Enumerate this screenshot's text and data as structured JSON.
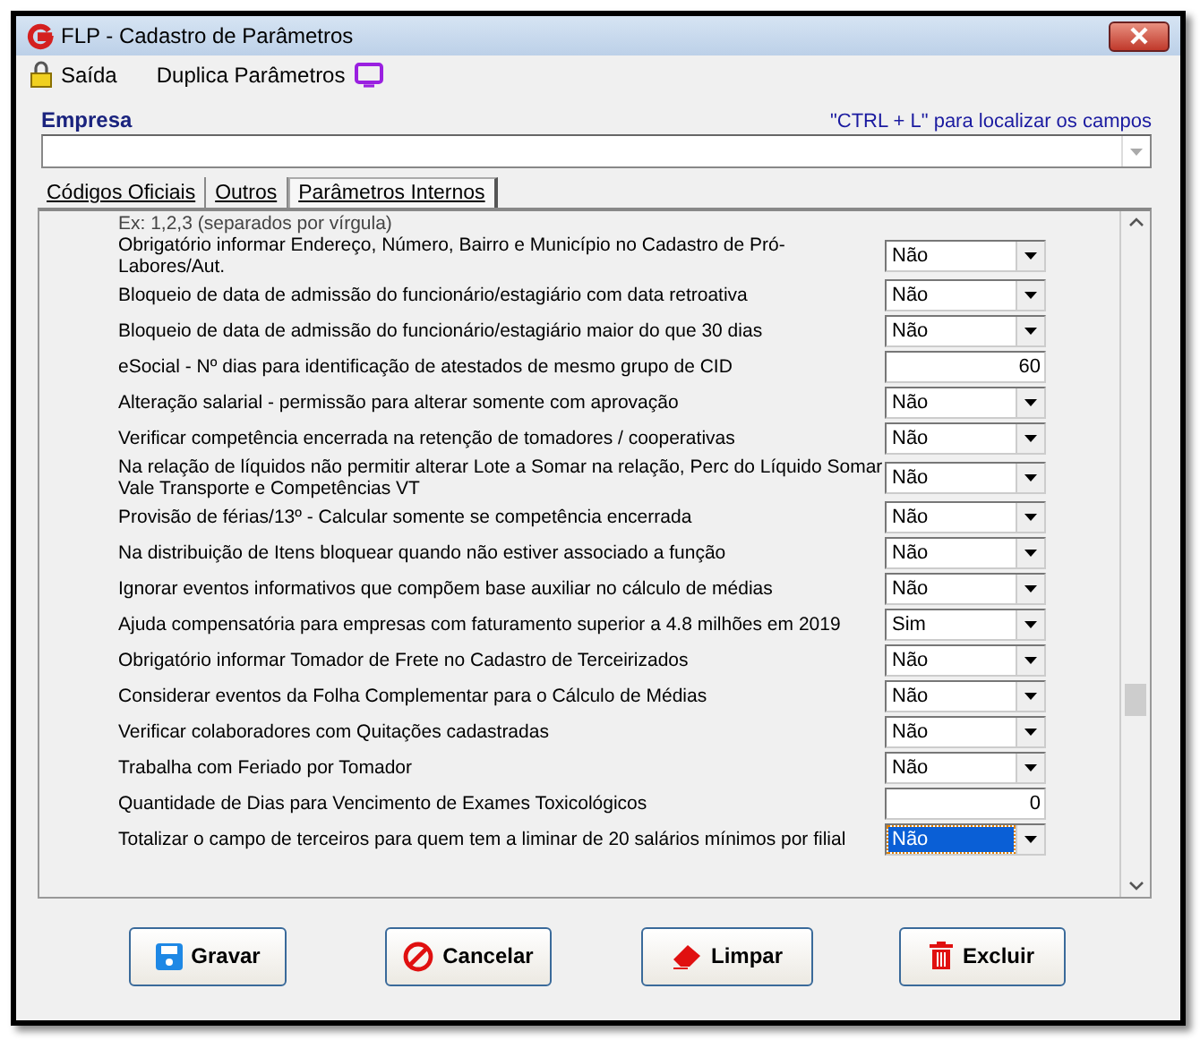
{
  "window": {
    "title": "FLP - Cadastro de Parâmetros"
  },
  "toolbar": [
    {
      "label": "Saída"
    },
    {
      "label": "Duplica Parâmetros"
    }
  ],
  "empresa": {
    "label": "Empresa",
    "hint": "\"CTRL + L\" para localizar os campos"
  },
  "tabs": [
    {
      "label": "Códigos Oficiais",
      "selected": false
    },
    {
      "label": "Outros",
      "selected": false
    },
    {
      "label": "Parâmetros Internos",
      "selected": true
    }
  ],
  "params": [
    {
      "kind": "note",
      "label": "Ex: 1,2,3 (separados por vírgula)"
    },
    {
      "kind": "select",
      "label": "Obrigatório informar Endereço, Número, Bairro e Município no Cadastro de Pró-Labores/Aut.",
      "value": "Não",
      "focused": false
    },
    {
      "kind": "select",
      "label": "Bloqueio de data de admissão do funcionário/estagiário com data retroativa",
      "value": "Não",
      "focused": false
    },
    {
      "kind": "select",
      "label": "Bloqueio de data de admissão do funcionário/estagiário maior do que 30 dias",
      "value": "Não",
      "focused": false
    },
    {
      "kind": "number",
      "label": "eSocial - Nº dias para identificação de atestados de mesmo grupo de CID",
      "value": "60"
    },
    {
      "kind": "select",
      "label": "Alteração salarial - permissão para alterar somente com aprovação",
      "value": "Não",
      "focused": false
    },
    {
      "kind": "select",
      "label": "Verificar competência encerrada na retenção de tomadores / cooperativas",
      "value": "Não",
      "focused": false
    },
    {
      "kind": "select",
      "label": "Na relação de líquidos não permitir alterar Lote a Somar na relação, Perc do Líquido Somar Vale Transporte e  Competências VT",
      "value": "Não",
      "focused": false
    },
    {
      "kind": "select",
      "label": "Provisão de férias/13º - Calcular somente se competência encerrada",
      "value": "Não",
      "focused": false
    },
    {
      "kind": "select",
      "label": "Na distribuição de Itens bloquear quando não estiver associado a função",
      "value": "Não",
      "focused": false
    },
    {
      "kind": "select",
      "label": "Ignorar eventos informativos que compõem base auxiliar no cálculo de médias",
      "value": "Não",
      "focused": false
    },
    {
      "kind": "select",
      "label": "Ajuda compensatória para empresas com faturamento superior a 4.8 milhões em 2019",
      "value": "Sim",
      "focused": false
    },
    {
      "kind": "select",
      "label": "Obrigatório informar Tomador de Frete no Cadastro de Terceirizados",
      "value": "Não",
      "focused": false
    },
    {
      "kind": "select",
      "label": "Considerar eventos da Folha Complementar para o Cálculo de Médias",
      "value": "Não",
      "focused": false
    },
    {
      "kind": "select",
      "label": "Verificar colaboradores com Quitações cadastradas",
      "value": "Não",
      "focused": false
    },
    {
      "kind": "select",
      "label": "Trabalha com Feriado por Tomador",
      "value": "Não",
      "focused": false
    },
    {
      "kind": "number",
      "label": "Quantidade de Dias para Vencimento de Exames Toxicológicos",
      "value": "0"
    },
    {
      "kind": "select",
      "label": "Totalizar o campo de terceiros para quem tem a liminar de 20 salários mínimos por filial",
      "value": "Não",
      "focused": true
    }
  ],
  "buttons": [
    {
      "label": "Gravar"
    },
    {
      "label": "Cancelar"
    },
    {
      "label": "Limpar"
    },
    {
      "label": "Excluir"
    }
  ]
}
